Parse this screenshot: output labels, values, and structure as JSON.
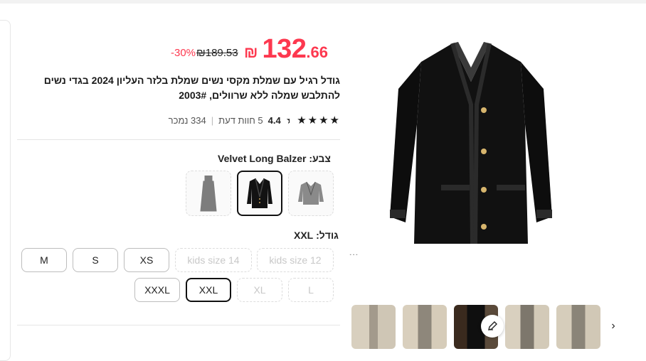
{
  "price": {
    "currency": "₪",
    "integer": "132",
    "decimal": ".66",
    "original": "₪189.53",
    "discount": "-30%"
  },
  "product": {
    "title": "גודל רגיל עם שמלת מקסי נשים שמלת בלזר העליון 2024 בגדי נשים להתלבש שמלה ללא שרוולים, 2003#"
  },
  "rating": {
    "value": "4.4",
    "reviews": "5 חוות דעת",
    "sold": "334 נמכר"
  },
  "color": {
    "label": "צבע:",
    "selected": "Velvet Long Balzer"
  },
  "size": {
    "label": "גודל:",
    "selected": "XXL",
    "row1": [
      "kids size 12",
      "kids size 14",
      "XS",
      "S",
      "M"
    ],
    "row2": [
      "L",
      "XL",
      "XXL",
      "XXXL"
    ]
  },
  "colors_meta": {
    "accent": "#fd384f",
    "text": "#191919"
  }
}
